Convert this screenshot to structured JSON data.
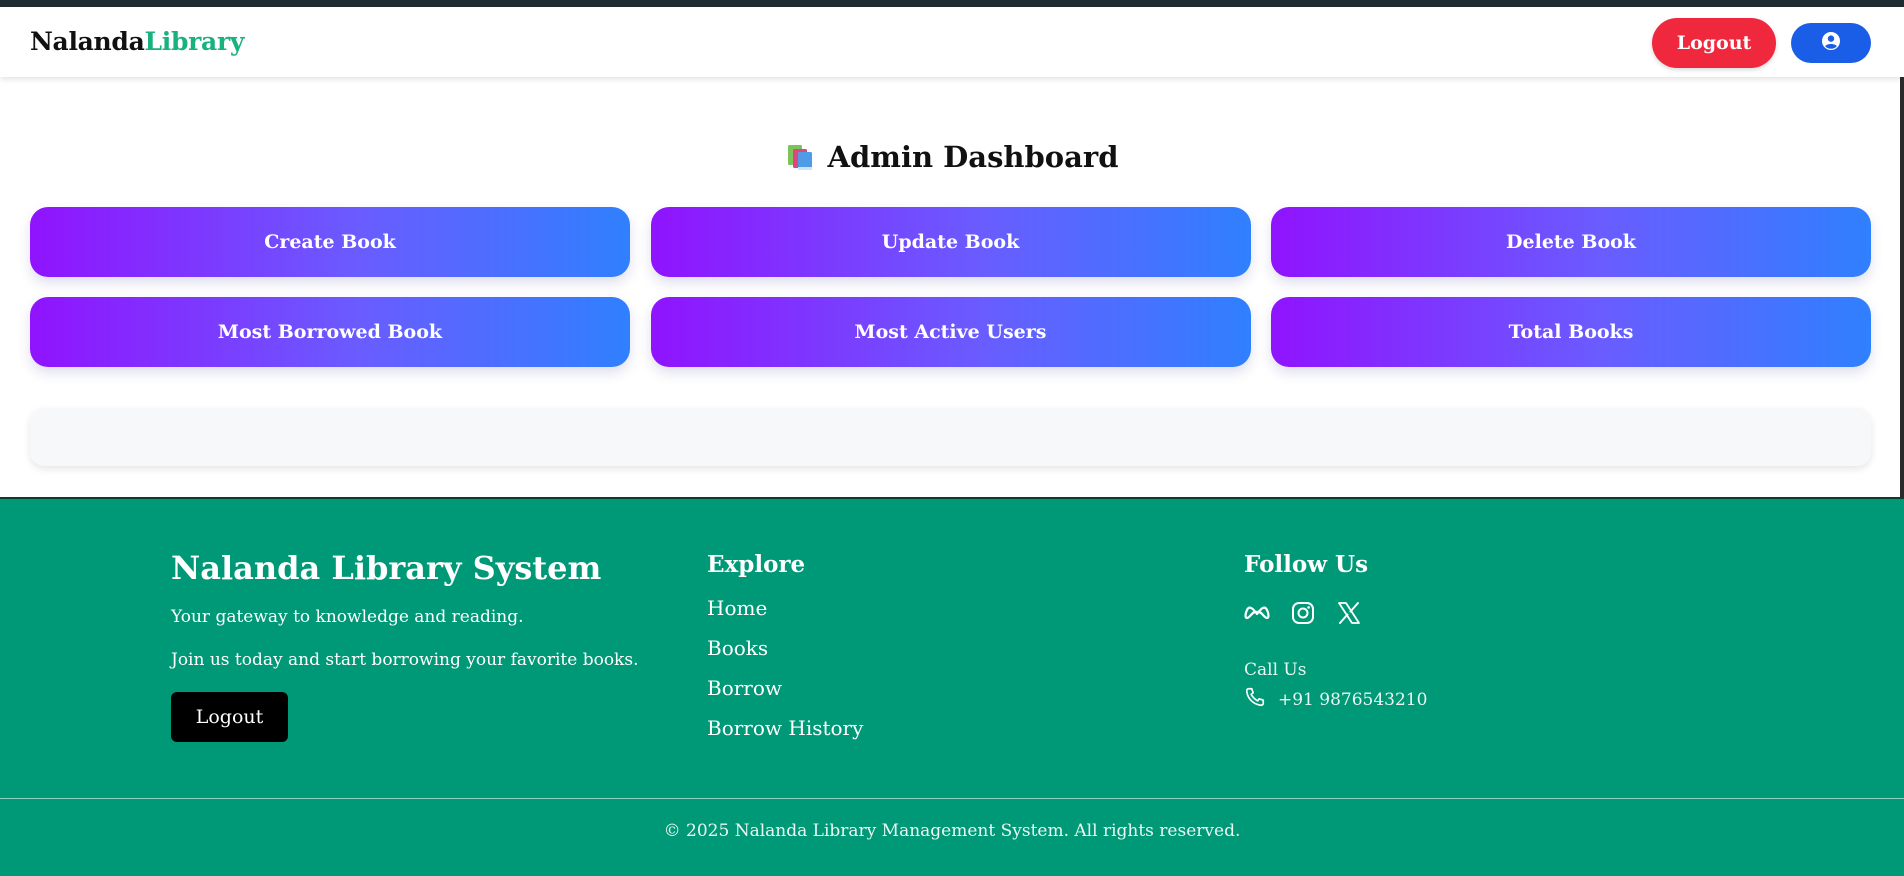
{
  "navbar": {
    "brand_part1": "Nalanda",
    "brand_part2": "Library",
    "logout_label": "Logout",
    "profile_icon": "user-circle-icon"
  },
  "main": {
    "title": "Admin Dashboard",
    "title_icon": "books-icon",
    "actions": [
      {
        "label": "Create Book"
      },
      {
        "label": "Update Book"
      },
      {
        "label": "Delete Book"
      },
      {
        "label": "Most Borrowed Book"
      },
      {
        "label": "Most Active Users"
      },
      {
        "label": "Total Books"
      }
    ]
  },
  "footer": {
    "title": "Nalanda Library System",
    "tagline": "Your gateway to knowledge and reading.",
    "cta": "Join us today and start borrowing your favorite books.",
    "logout_label": "Logout",
    "explore_heading": "Explore",
    "links": [
      {
        "label": "Home"
      },
      {
        "label": "Books"
      },
      {
        "label": "Borrow"
      },
      {
        "label": "Borrow History"
      }
    ],
    "follow_heading": "Follow Us",
    "social_icons": [
      "meta-icon",
      "instagram-icon",
      "x-icon"
    ],
    "call_label": "Call Us",
    "phone": "+91 9876543210",
    "copyright": "© 2025 Nalanda Library Management System. All rights reserved."
  },
  "colors": {
    "brand_accent": "#18b27d",
    "logout_red": "#f0283d",
    "profile_blue": "#1a5ee8",
    "gradient_start": "#9013fe",
    "gradient_end": "#2f80ff",
    "footer_bg": "#009977"
  }
}
